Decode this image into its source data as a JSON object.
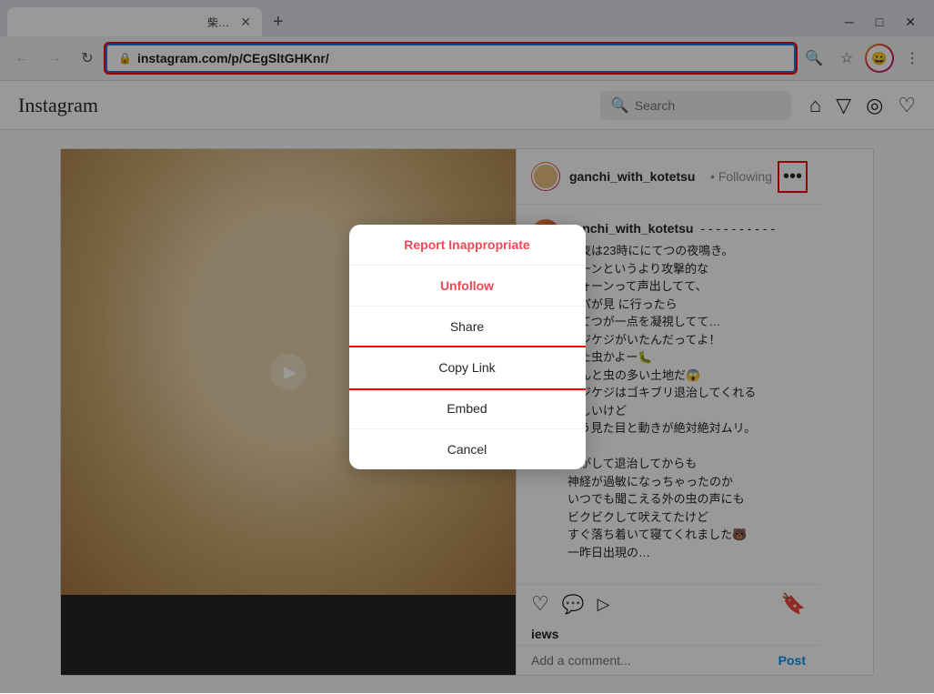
{
  "browser": {
    "tab": {
      "title": "柴犬こてつ君 on Instagram: \"- - - ×",
      "favicon_alt": "Instagram favicon"
    },
    "new_tab_label": "+",
    "nav": {
      "back_label": "←",
      "forward_label": "→",
      "reload_label": "↻",
      "url": "instagram.com/p/CEgSltGHKnr/",
      "url_bold": "instagram.com",
      "url_rest": "/p/CEgSltGHKnr/",
      "search_label": "🔍",
      "star_label": "☆",
      "more_label": "⋮"
    },
    "window_controls": {
      "minimize": "─",
      "maximize": "□",
      "close": "✕"
    }
  },
  "instagram": {
    "logo": "Instagram",
    "search_placeholder": "Search",
    "nav_icons": [
      "🏠",
      "▽",
      "◎",
      "♡"
    ]
  },
  "post": {
    "username": "ganchi_with_kotetsu",
    "following_label": "• Following",
    "more_btn_label": "•••",
    "caption_username": "ganchi_with_kotetsu",
    "caption_dashes": "- - - - - - - - - -",
    "caption_text": "昨夜は23時ににてつの夜鳴き。\nクーンというより攻撃的な\nウォーンって声出してて、\nパパが見 に行ったら\nこてつが一点を凝視してて…\nケジケジがいたんだってよ！\nまた虫かよー🐛\nほんと虫の多い土地だ😱\nケジケジはゴキブリ退治してくれる\nらしいけど\nもう見た目と動きが絶対絶対ムリ。\n\nカがして退治してからも\n神経が過敏になっちゃったのか\nいつでも聞こえる外の虫の声にも\nビクビクして吠えてたけど\nすぐ落ち着いて寝てくれました🐻\n一昨日出現の…",
    "views": "iews",
    "comment_placeholder": "Add a comment...",
    "post_btn": "Post"
  },
  "modal": {
    "items": [
      {
        "label": "Report Inappropriate",
        "type": "report"
      },
      {
        "label": "Unfollow",
        "type": "unfollow"
      },
      {
        "label": "Share",
        "type": "normal"
      },
      {
        "label": "Copy Link",
        "type": "copy-link"
      },
      {
        "label": "Embed",
        "type": "normal"
      },
      {
        "label": "Cancel",
        "type": "normal"
      }
    ]
  },
  "icons": {
    "heart": "♡",
    "comment": "💬",
    "share": "▷",
    "bookmark": "🔖",
    "search": "🔍",
    "home": "⌂"
  }
}
